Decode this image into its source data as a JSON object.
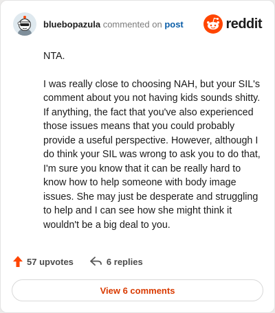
{
  "header": {
    "username": "bluebopazula",
    "action_text": "commented on",
    "post_link": "post",
    "brand_name": "reddit",
    "brand_color": "#ff4500"
  },
  "comment": {
    "paragraphs": [
      "NTA.",
      "I was really close to choosing NAH, but your SIL's comment about you not having kids sounds shitty. If anything, the fact that you've also experienced those issues means that you could probably provide a useful perspective. However, although I do think your SIL was wrong to ask you to do that, I'm sure you know that it can be really hard to know how to help someone with body image issues. She may just be desperate and struggling to help and I can see how she might think it wouldn't be a big deal to you."
    ]
  },
  "actions": {
    "upvotes_label": "57 upvotes",
    "replies_label": "6 replies",
    "upvote_icon": "upvote-arrow-icon",
    "reply_icon": "reply-arrow-icon",
    "upvote_color": "#ff4500"
  },
  "footer": {
    "view_comments_label": "View 6 comments",
    "accent_color": "#d93a00"
  }
}
